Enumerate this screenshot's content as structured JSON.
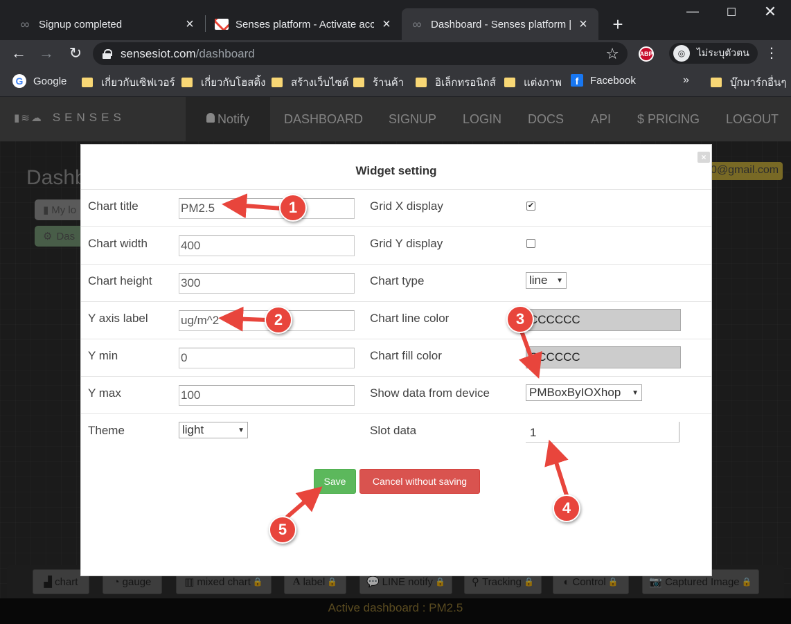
{
  "browser": {
    "tabs": [
      {
        "title": "Signup completed",
        "icon": "loop-icon"
      },
      {
        "title": "Senses platform - Activate acco",
        "icon": "gmail-icon"
      },
      {
        "title": "Dashboard - Senses platform |",
        "icon": "loop-icon"
      }
    ],
    "url_host": "sensesiot.com",
    "url_path": "/dashboard",
    "profile_label": "ไม่ระบุตัวตน",
    "extension_label": "ABP"
  },
  "bookmarks": [
    "Google",
    "เกี่ยวกับเซิฟเวอร์",
    "เกี่ยวกับโฮสติ้ง",
    "สร้างเว็บไซต์",
    "ร้านค้า",
    "อิเล็กทรอนิกส์",
    "แต่งภาพ",
    "Facebook"
  ],
  "bookmarks_more": "»",
  "bookmarks_other": "บุ๊กมาร์กอื่นๆ",
  "site": {
    "brand": "SENSES",
    "nav": [
      "Notify",
      "DASHBOARD",
      "SIGNUP",
      "LOGIN",
      "DOCS",
      "API",
      "$ PRICING",
      "LOGOUT"
    ],
    "page_title": "Dashb",
    "side_buttons": [
      "My lo",
      "Das"
    ],
    "email_fragment": "0@gmail.com",
    "widget_buttons": [
      {
        "label": "chart",
        "locked": false
      },
      {
        "label": "gauge",
        "locked": false
      },
      {
        "label": "mixed chart",
        "locked": true
      },
      {
        "label": "label",
        "locked": true
      },
      {
        "label": "LINE notify",
        "locked": true
      },
      {
        "label": "Tracking",
        "locked": true
      },
      {
        "label": "Control",
        "locked": true
      },
      {
        "label": "Captured Image",
        "locked": true
      }
    ],
    "active_dashboard": "Active dashboard : PM2.5"
  },
  "modal": {
    "title": "Widget setting",
    "close_label": "×",
    "left_fields": [
      {
        "label": "Chart title",
        "value": "PM2.5"
      },
      {
        "label": "Chart width",
        "value": "400"
      },
      {
        "label": "Chart height",
        "value": "300"
      },
      {
        "label": "Y axis label",
        "value": "ug/m^2"
      },
      {
        "label": "Y min",
        "value": "0"
      },
      {
        "label": "Y max",
        "value": "100"
      }
    ],
    "theme": {
      "label": "Theme",
      "value": "light"
    },
    "grid_x": {
      "label": "Grid X display",
      "checked": true,
      "mark": "✔"
    },
    "grid_y": {
      "label": "Grid Y display",
      "checked": false,
      "mark": ""
    },
    "chart_type": {
      "label": "Chart type",
      "value": "line"
    },
    "line_color": {
      "label": "Chart line color",
      "value": "CCCCCC"
    },
    "fill_color": {
      "label": "Chart fill color",
      "value": "CCCCCC"
    },
    "device": {
      "label": "Show data from device",
      "value": "PMBoxByIOXhop"
    },
    "slot": {
      "label": "Slot data",
      "value": "1"
    },
    "save_label": "Save",
    "cancel_label": "Cancel without saving"
  },
  "markers": [
    "1",
    "2",
    "3",
    "4",
    "5"
  ],
  "colors": {
    "accent_red": "#e8453c",
    "save_green": "#5cb85c",
    "cancel_red": "#d9534f",
    "color_field": "#cccccc"
  }
}
